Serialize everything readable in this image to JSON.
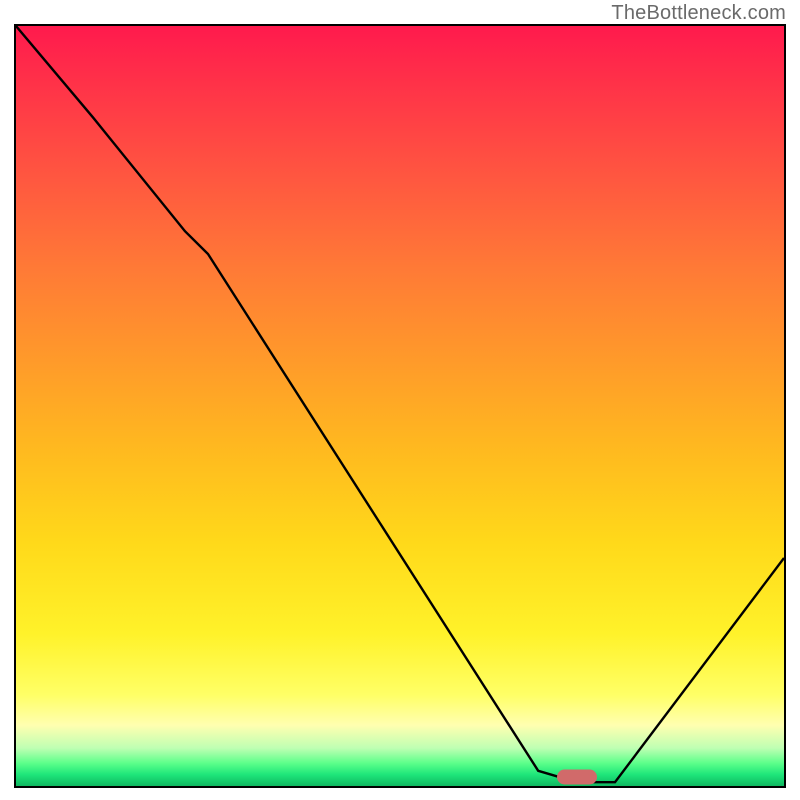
{
  "watermark": "TheBottleneck.com",
  "chart_data": {
    "type": "line",
    "title": "",
    "xlabel": "",
    "ylabel": "",
    "xlim": [
      0,
      100
    ],
    "ylim": [
      0,
      100
    ],
    "series": [
      {
        "name": "curve",
        "x": [
          0,
          10,
          22,
          25,
          68,
          73,
          78,
          100
        ],
        "values": [
          100,
          88,
          73,
          70,
          2,
          0.5,
          0.5,
          30
        ]
      }
    ],
    "marker": {
      "x": 73,
      "y": 1.2,
      "color": "#d16a6a"
    },
    "gradient_stops": [
      {
        "pct": 0,
        "color": "#ff1a4d"
      },
      {
        "pct": 20,
        "color": "#ff5740"
      },
      {
        "pct": 44,
        "color": "#ff9a2a"
      },
      {
        "pct": 68,
        "color": "#ffd91a"
      },
      {
        "pct": 88,
        "color": "#ffff66"
      },
      {
        "pct": 95,
        "color": "#bfffb3"
      },
      {
        "pct": 100,
        "color": "#0fb860"
      }
    ]
  }
}
